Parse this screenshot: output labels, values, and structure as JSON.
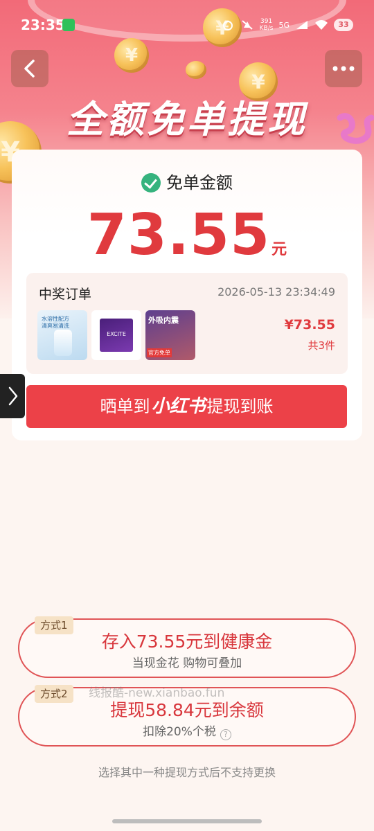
{
  "status_bar": {
    "time": "23:35",
    "net_speed_value": "391",
    "net_speed_unit": "KB/s",
    "network_type": "5G",
    "battery": "33"
  },
  "hero": {
    "title": "全额免单提现"
  },
  "card": {
    "label": "免单金额",
    "amount": "73.55",
    "unit": "元",
    "order": {
      "title": "中奖订单",
      "time": "2026-05-13 23:34:49",
      "price": "¥73.55",
      "count": "共3件",
      "thumbs": {
        "t1_line1": "水溶性配方",
        "t1_line2": "清爽易清洗",
        "t2_label": "EXCITE",
        "t3_label": "外吸内震",
        "t3_badge": "官方免单"
      }
    },
    "cta": {
      "prefix": "晒单到",
      "brand": "小红书",
      "suffix": "提现到账"
    }
  },
  "options": [
    {
      "tag": "方式1",
      "main": "存入73.55元到健康金",
      "sub": "当现金花 购物可叠加"
    },
    {
      "tag": "方式2",
      "main": "提现58.84元到余额",
      "sub": "扣除20%个税"
    }
  ],
  "watermark": "线报酷-new.xianbao.fun",
  "footer_note": "选择其中一种提现方式后不支持更换",
  "colors": {
    "accent_red": "#ec4148",
    "amount_red": "#e03a3e",
    "check_green": "#36b37e"
  }
}
